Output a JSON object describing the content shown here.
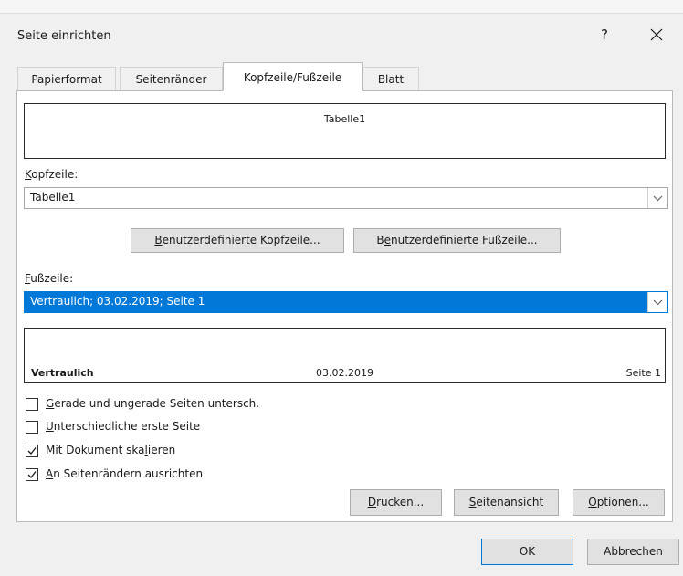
{
  "window": {
    "title": "Seite einrichten",
    "help_label": "?",
    "close_label": "✕"
  },
  "tabs": [
    {
      "label": "Papierformat",
      "active": false
    },
    {
      "label": "Seitenränder",
      "active": false
    },
    {
      "label": "Kopfzeile/Fußzeile",
      "active": true
    },
    {
      "label": "Blatt",
      "active": false
    }
  ],
  "header_preview": {
    "center": "Tabelle1"
  },
  "header_field": {
    "label_key": "K",
    "label_rest": "opfzeile:",
    "value": "Tabelle1"
  },
  "custom_buttons": {
    "header_key": "B",
    "header_rest": "enutzerdefinierte Kopfzeile...",
    "footer_pre": "B",
    "footer_key": "e",
    "footer_rest": "nutzerdefinierte Fußzeile..."
  },
  "footer_field": {
    "label_key": "F",
    "label_rest": "ußzeile:",
    "value": "Vertraulich; 03.02.2019; Seite 1"
  },
  "footer_preview": {
    "left": "Vertraulich",
    "center": "03.02.2019",
    "right": "Seite 1"
  },
  "options": [
    {
      "key": "G",
      "rest": "erade und ungerade Seiten untersch.",
      "checked": false
    },
    {
      "key": "U",
      "rest": "nterschiedliche erste Seite",
      "checked": false
    },
    {
      "pre": "Mit Dokument ska",
      "key": "l",
      "rest": "ieren",
      "checked": true
    },
    {
      "key": "A",
      "rest": "n Seitenrändern ausrichten",
      "checked": true
    }
  ],
  "action_buttons": {
    "print_key": "D",
    "print_rest": "rucken...",
    "preview_key": "S",
    "preview_rest": "eitenansicht",
    "options_key": "O",
    "options_rest": "ptionen..."
  },
  "footer_buttons": {
    "ok": "OK",
    "cancel": "Abbrechen"
  },
  "colors": {
    "selection": "#0078d7",
    "dialog_bg": "#f0f0f0"
  }
}
